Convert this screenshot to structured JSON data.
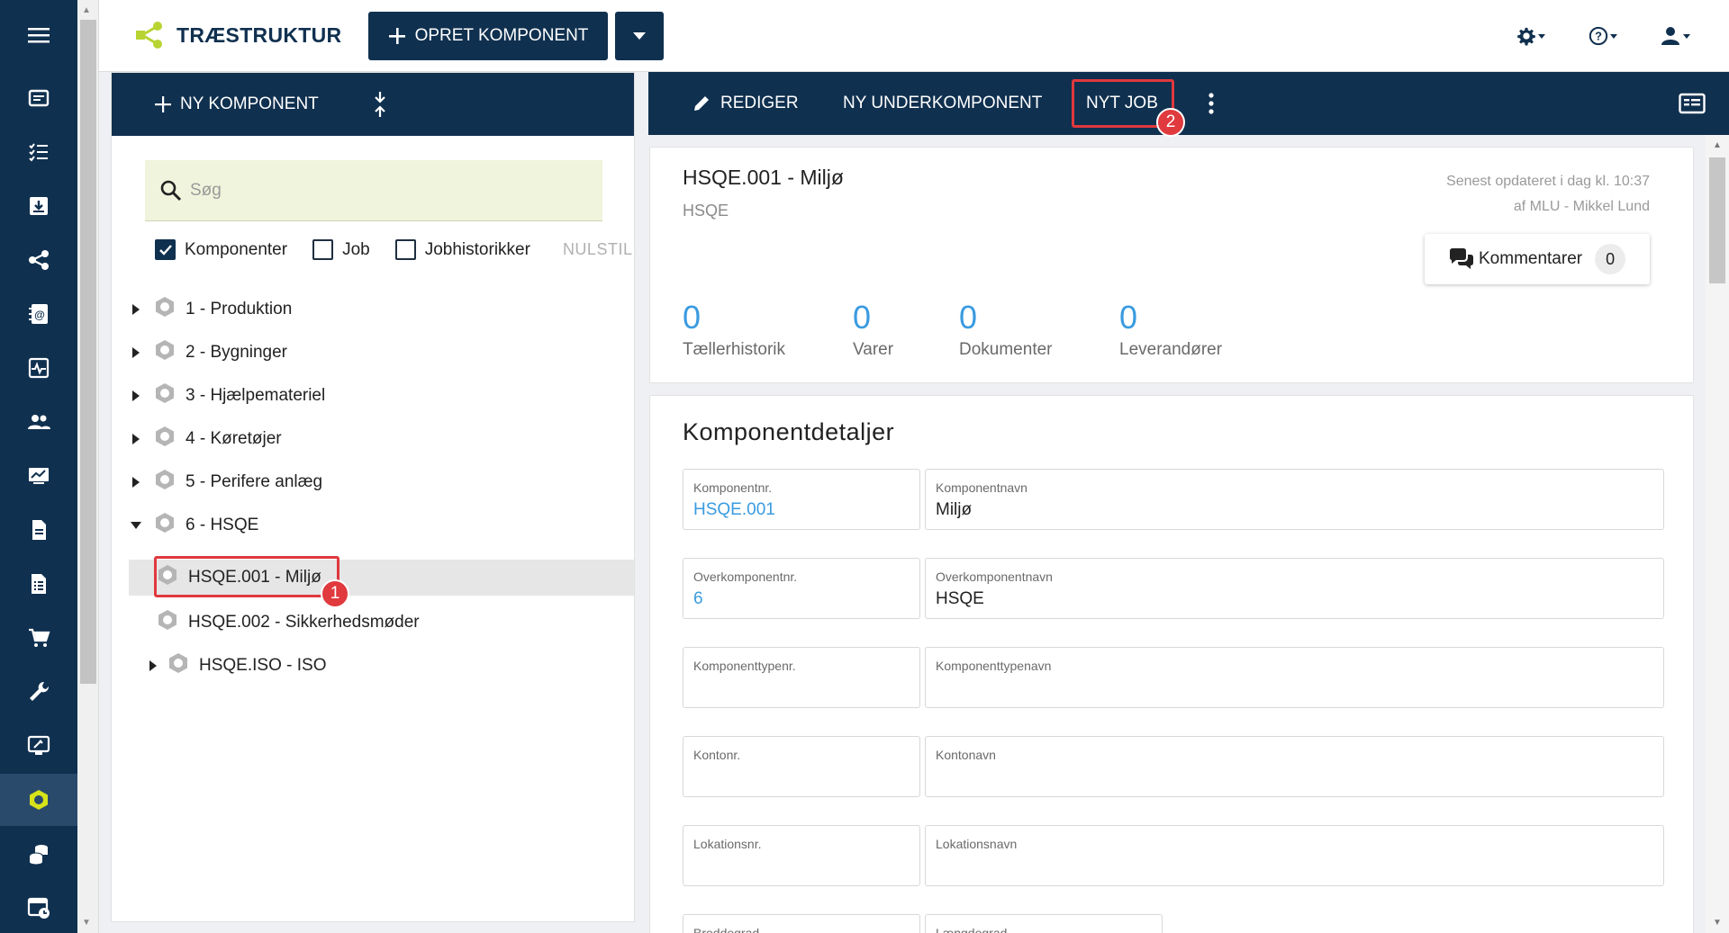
{
  "app": {
    "title": "TRÆSTRUKTUR",
    "create_button": "OPRET KOMPONENT",
    "brand_color": "#b8d432",
    "nav_color": "#10304f"
  },
  "rail": {
    "icons": [
      "menu-icon",
      "card-icon",
      "checklist-icon",
      "download-icon",
      "share-icon",
      "contact-book-icon",
      "pulse-icon",
      "users-icon",
      "chart-icon",
      "document-icon",
      "list-document-icon",
      "cart-icon",
      "wrench-icon",
      "tools-screen-icon",
      "component-icon",
      "coins-icon",
      "calendar-clock-icon"
    ],
    "active": "component-icon"
  },
  "left_panel": {
    "new_component": "NY KOMPONENT",
    "search_placeholder": "Søg",
    "filters": [
      {
        "label": "Komponenter",
        "checked": true
      },
      {
        "label": "Job",
        "checked": false
      },
      {
        "label": "Jobhistorikker",
        "checked": false
      }
    ],
    "reset": "NULSTIL",
    "tree": [
      {
        "label": "1 - Produktion",
        "level": 0,
        "expandable": true,
        "expanded": false
      },
      {
        "label": "2 - Bygninger",
        "level": 0,
        "expandable": true,
        "expanded": false
      },
      {
        "label": "3 - Hjælpemateriel",
        "level": 0,
        "expandable": true,
        "expanded": false
      },
      {
        "label": "4 - Køretøjer",
        "level": 0,
        "expandable": true,
        "expanded": false
      },
      {
        "label": "5 - Perifere anlæg",
        "level": 0,
        "expandable": true,
        "expanded": false
      },
      {
        "label": "6 - HSQE",
        "level": 0,
        "expandable": true,
        "expanded": true
      },
      {
        "label": "HSQE.001 - Miljø",
        "level": 1,
        "expandable": false,
        "selected": true
      },
      {
        "label": "HSQE.002 - Sikkerhedsmøder",
        "level": 1,
        "expandable": false
      },
      {
        "label": "HSQE.ISO - ISO",
        "level": 1,
        "expandable": true,
        "expanded": false
      }
    ]
  },
  "toolbar": {
    "edit": "REDIGER",
    "new_sub": "NY UNDERKOMPONENT",
    "new_job": "NYT JOB"
  },
  "annotations": {
    "badge1": "1",
    "badge2": "2",
    "color": "#e0393e"
  },
  "summary": {
    "title": "HSQE.001 - Miljø",
    "subtitle": "HSQE",
    "updated_line1": "Senest opdateret i dag kl. 10:37",
    "updated_line2": "af MLU - Mikkel Lund",
    "comments_label": "Kommentarer",
    "comments_count": "0",
    "stats": [
      {
        "value": "0",
        "label": "Tællerhistorik"
      },
      {
        "value": "0",
        "label": "Varer"
      },
      {
        "value": "0",
        "label": "Dokumenter"
      },
      {
        "value": "0",
        "label": "Leverandører"
      }
    ]
  },
  "details": {
    "title": "Komponentdetaljer",
    "rows": [
      [
        {
          "label": "Komponentnr.",
          "value": "HSQE.001",
          "link": true
        },
        {
          "label": "Komponentnavn",
          "value": "Miljø"
        }
      ],
      [
        {
          "label": "Overkomponentnr.",
          "value": "6",
          "link": true
        },
        {
          "label": "Overkomponentnavn",
          "value": "HSQE"
        }
      ],
      [
        {
          "label": "Komponenttypenr.",
          "value": ""
        },
        {
          "label": "Komponenttypenavn",
          "value": ""
        }
      ],
      [
        {
          "label": "Kontonr.",
          "value": ""
        },
        {
          "label": "Kontonavn",
          "value": ""
        }
      ],
      [
        {
          "label": "Lokationsnr.",
          "value": ""
        },
        {
          "label": "Lokationsnavn",
          "value": ""
        }
      ]
    ],
    "partial_fields": [
      "Breddegrad",
      "Længdegrad"
    ]
  }
}
